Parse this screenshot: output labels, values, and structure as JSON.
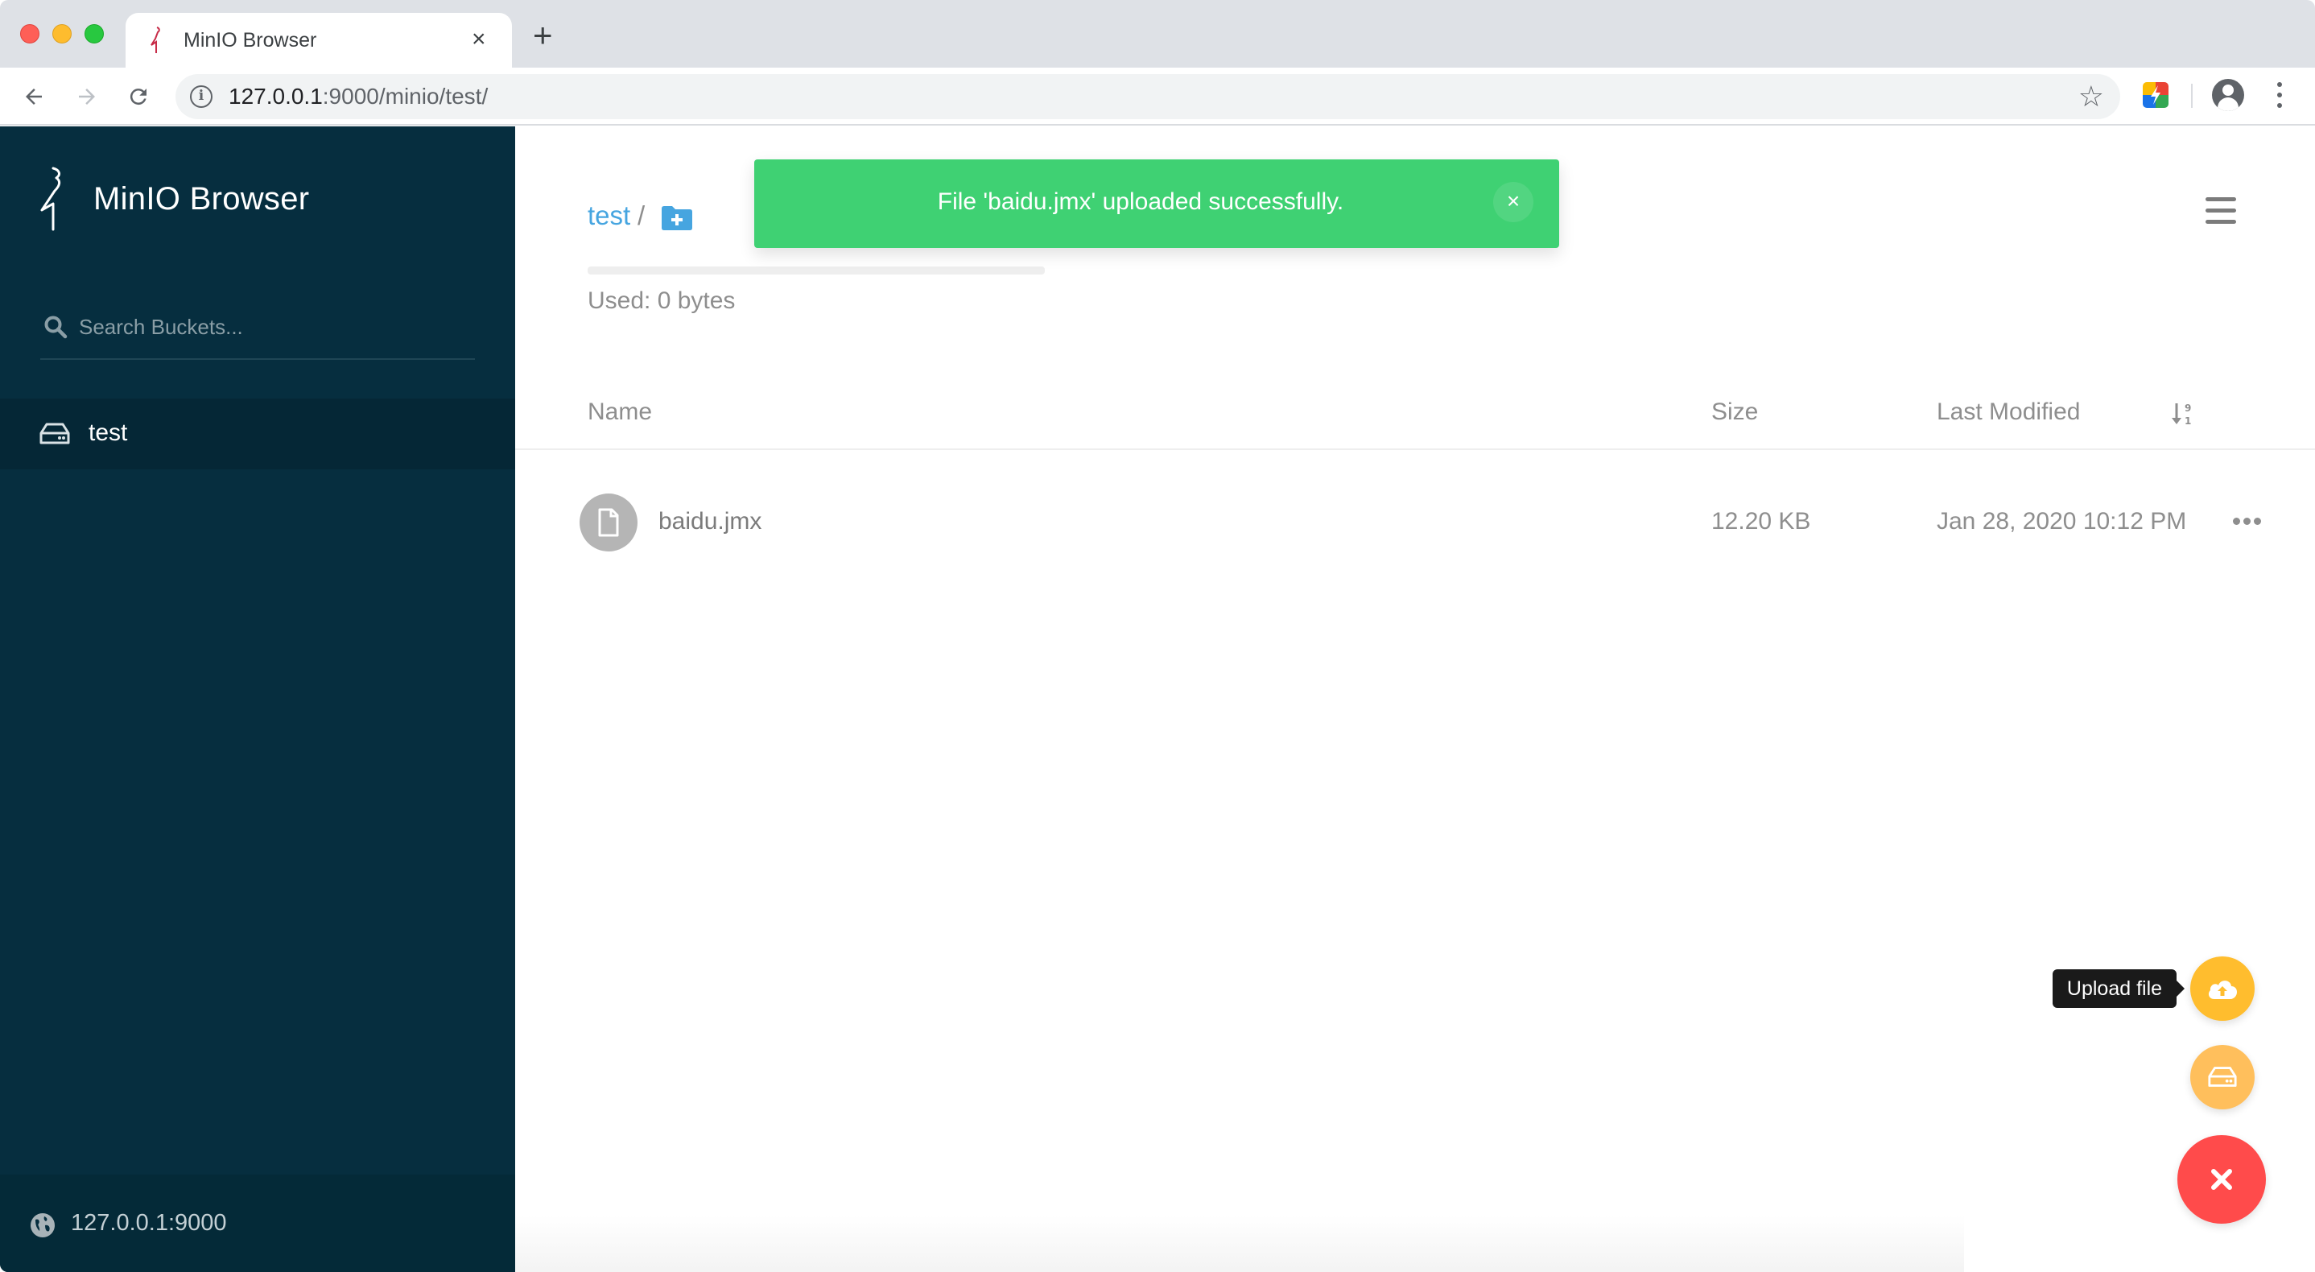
{
  "browser": {
    "tab_title": "MinIO Browser",
    "tab_close_glyph": "×",
    "new_tab_glyph": "+",
    "url_host": "127.0.0.1",
    "url_rest": ":9000/minio/test/",
    "icons": [
      "back-arrow-icon",
      "forward-arrow-icon",
      "reload-icon",
      "info-icon",
      "star-icon",
      "extension-icon",
      "profile-icon",
      "kebab-menu-icon"
    ]
  },
  "sidebar": {
    "brand": "MinIO Browser",
    "search_placeholder": "Search Buckets...",
    "buckets": [
      {
        "label": "test",
        "active": true
      }
    ],
    "host": "127.0.0.1:9000"
  },
  "main": {
    "breadcrumb": {
      "bucket": "test",
      "separator": "/"
    },
    "usage": {
      "text": "Used: 0 bytes",
      "fraction": 0
    },
    "table": {
      "headers": {
        "name": "Name",
        "size": "Size",
        "modified": "Last Modified"
      },
      "rows": [
        {
          "name": "baidu.jmx",
          "size": "12.20 KB",
          "modified": "Jan 28, 2020 10:12 PM"
        }
      ]
    }
  },
  "toast": {
    "message": "File 'baidu.jmx' uploaded successfully.",
    "close_glyph": "×",
    "color": "#3fd173"
  },
  "fab": {
    "tooltip": "Upload file",
    "colors": {
      "upload": "#ffbd2e",
      "bucket": "#ffbf5c",
      "close": "#ff4b4b"
    }
  }
}
